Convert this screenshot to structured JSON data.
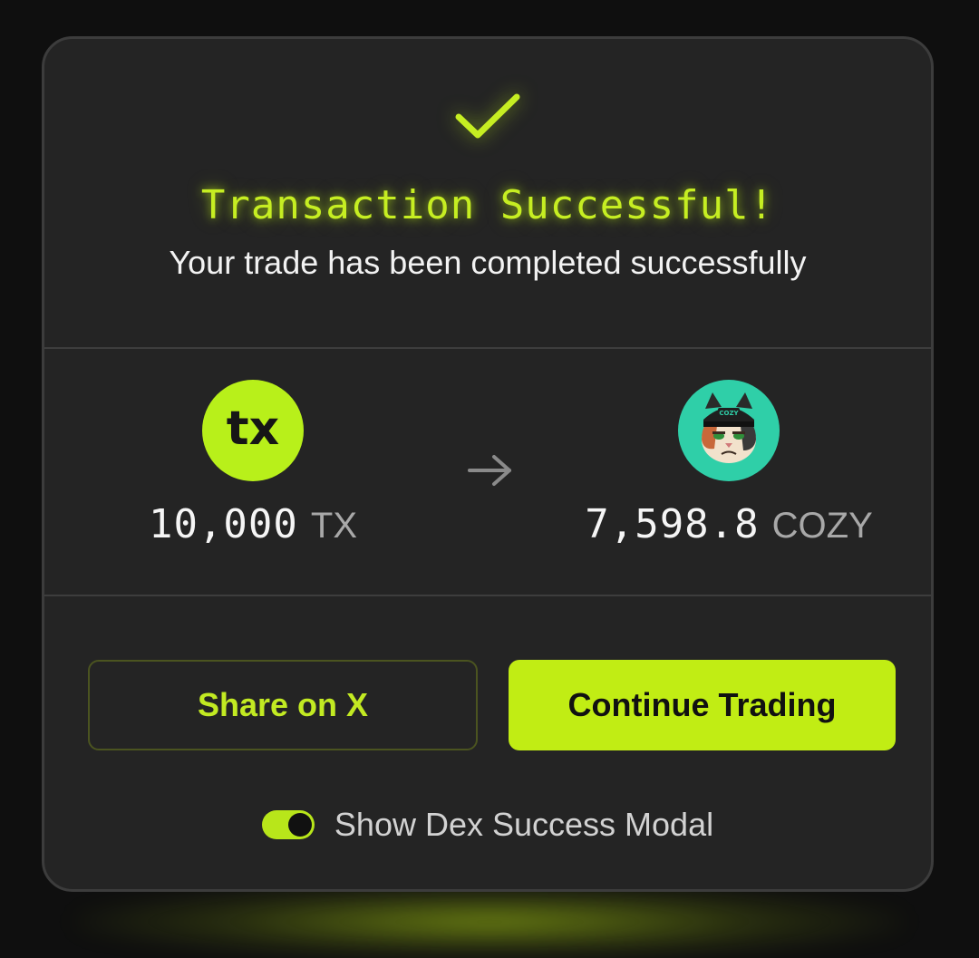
{
  "modal": {
    "title": "Transaction Successful!",
    "subtitle": "Your trade has been completed successfully"
  },
  "trade": {
    "from": {
      "amount": "10,000",
      "symbol": "TX",
      "logo_icon": "tx-logo-icon",
      "logo_text": "tx"
    },
    "to": {
      "amount": "7,598.8",
      "symbol": "COZY",
      "logo_icon": "cozy-cat-logo-icon",
      "logo_text": "COZY"
    },
    "arrow_icon": "arrow-right-icon"
  },
  "actions": {
    "share_label": "Share on X",
    "continue_label": "Continue Trading"
  },
  "setting": {
    "toggle_label": "Show Dex Success Modal",
    "toggle_on": true
  },
  "colors": {
    "accent": "#c1ed14",
    "modal_bg": "#242424",
    "page_bg": "#0f0f0f",
    "cozy_bg": "#2fcfa8"
  }
}
